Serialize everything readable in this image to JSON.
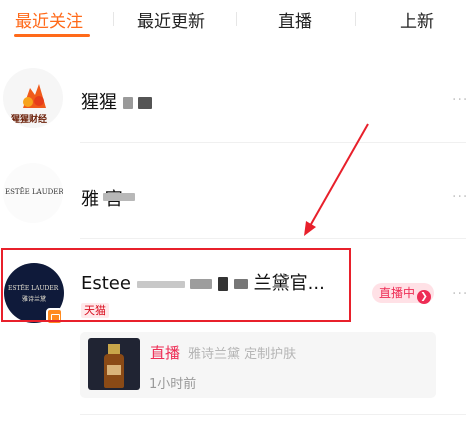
{
  "tabs": [
    {
      "label": "最近关注",
      "active": true
    },
    {
      "label": "最近更新",
      "active": false
    },
    {
      "label": "直播",
      "active": false
    },
    {
      "label": "上新",
      "active": false
    }
  ],
  "shops": [
    {
      "logo_text": "猩猩财经",
      "name_visible": "猩猩",
      "icon": "orange-flame-logo"
    },
    {
      "logo_text": "ESTĒE LAUDER",
      "name_visible": "雅 官",
      "icon": "estee-lauder-wordmark"
    },
    {
      "logo_text_line1": "ESTĒE LAUDER",
      "logo_text_line2": "雅诗兰黛",
      "name_prefix": "Estee",
      "name_suffix": "兰黛官...",
      "tag": "天猫",
      "live_label": "直播中",
      "live_arrow": "❯"
    }
  ],
  "live_card": {
    "tag": "直播",
    "title": "雅诗兰黛 定制护肤",
    "time": "1小时前"
  },
  "more_glyph": "···",
  "colors": {
    "accent": "#ff6a1a",
    "live": "#ee2d55",
    "annotation": "#e8202b"
  }
}
